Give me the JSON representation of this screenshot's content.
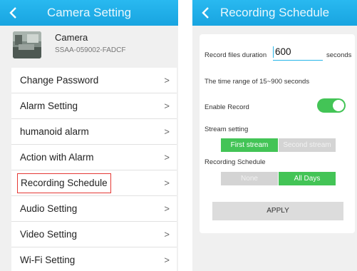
{
  "left": {
    "header": {
      "title": "Camera Setting"
    },
    "camera": {
      "name": "Camera",
      "id": "SSAA-059002-FADCF"
    },
    "menu": [
      {
        "label": "Change Password",
        "chevron": ">"
      },
      {
        "label": "Alarm Setting",
        "chevron": ">"
      },
      {
        "label": "humanoid alarm",
        "chevron": ">"
      },
      {
        "label": "Action with Alarm",
        "chevron": ">"
      },
      {
        "label": "Recording Schedule",
        "chevron": ">"
      },
      {
        "label": "Audio Setting",
        "chevron": ">"
      },
      {
        "label": "Video Setting",
        "chevron": ">"
      },
      {
        "label": "Wi-Fi Setting",
        "chevron": ">"
      }
    ]
  },
  "right": {
    "header": {
      "title": "Recording Schedule"
    },
    "duration": {
      "label": "Record files duration",
      "value": "600",
      "unit": "seconds"
    },
    "range_note": "The time range of 15~900 seconds",
    "enable_record": {
      "label": "Enable Record",
      "on": true
    },
    "stream": {
      "label": "Stream setting",
      "options": [
        "First stream",
        "Second stream"
      ],
      "selected": "First stream"
    },
    "schedule": {
      "label": "Recording Schedule",
      "options": [
        "None",
        "All Days"
      ],
      "selected": "All Days"
    },
    "apply_label": "APPLY"
  },
  "colors": {
    "header": "#1ca9e6",
    "accent_green": "#43c456",
    "highlight_border": "#e53935"
  }
}
